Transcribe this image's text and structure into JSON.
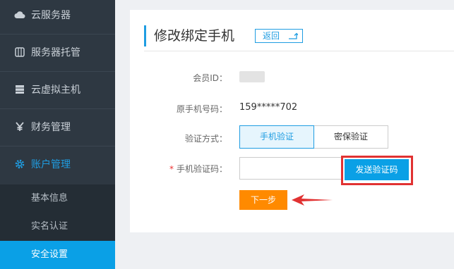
{
  "sidebar": {
    "items": [
      {
        "label": "云服务器",
        "icon": "cloud-icon"
      },
      {
        "label": "服务器托管",
        "icon": "server-rack-icon"
      },
      {
        "label": "云虚拟主机",
        "icon": "virtual-host-icon"
      },
      {
        "label": "财务管理",
        "icon": "yen-icon"
      },
      {
        "label": "账户管理",
        "icon": "gear-icon",
        "active": true
      }
    ],
    "subitems": [
      {
        "label": "基本信息"
      },
      {
        "label": "实名认证"
      },
      {
        "label": "安全设置",
        "current": true
      }
    ]
  },
  "panel": {
    "title": "修改绑定手机",
    "back_label": "返回"
  },
  "form": {
    "member_id_label": "会员ID：",
    "phone_label": "原手机号码：",
    "phone_value": "159*****702",
    "method_label": "验证方式：",
    "method_phone": "手机验证",
    "method_security": "密保验证",
    "required_mark": "*",
    "code_label": "手机验证码：",
    "code_value": "",
    "send_code_label": "发送验证码",
    "next_label": "下一步"
  },
  "colors": {
    "accent": "#1f9de2",
    "sidebar_bg": "#2e3842",
    "submenu_bg": "#242d35",
    "current_sub": "#0aa0e6",
    "next_button": "#ff8a00",
    "annotation_red": "#e13232"
  }
}
